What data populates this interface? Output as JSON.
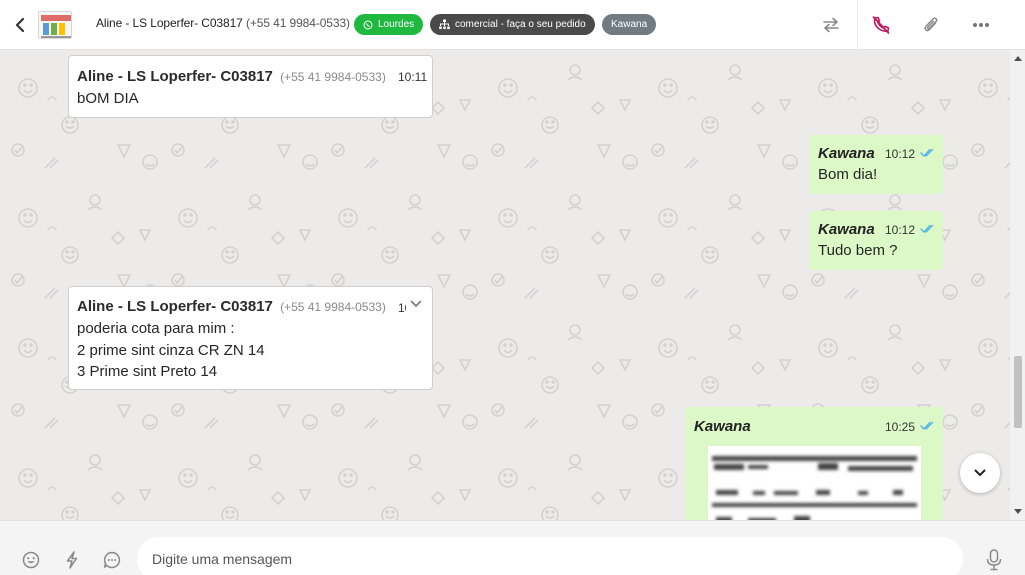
{
  "header": {
    "contact_name": "Aline - LS Loperfer- C03817",
    "contact_phone": "(+55 41 9984-0533)",
    "tags": {
      "lourdes": "Lourdes",
      "comercial": "comercial - faça o seu pedido",
      "kawana": "Kawana"
    },
    "colors": {
      "lourdes": "#1fb93f",
      "comercial": "#4a4a4a",
      "kawana": "#727b82",
      "phone_icon": "#c2185b"
    },
    "icons": [
      "back-arrow-icon",
      "transfer-icon",
      "end-call-icon",
      "paperclip-icon",
      "more-icon"
    ]
  },
  "messages": {
    "m1": {
      "sender": "Aline - LS Loperfer- C03817",
      "phone": "(+55 41 9984-0533)",
      "time": "10:11",
      "text": "bOM DIA"
    },
    "m2": {
      "sender": "Kawana",
      "time": "10:12",
      "text": "Bom dia!"
    },
    "m3": {
      "sender": "Kawana",
      "time": "10:12",
      "text": "Tudo bem ?"
    },
    "m4": {
      "sender": "Aline - LS Loperfer- C03817",
      "phone": "(+55 41 9984-0533)",
      "time": "10",
      "lines": [
        "poderia cota para mim :",
        "2 prime sint cinza CR ZN 14",
        "3 Prime sint Preto 14"
      ]
    },
    "m5": {
      "sender": "Kawana",
      "time": "10:25"
    }
  },
  "input": {
    "placeholder": "Digite uma mensagem"
  },
  "colors": {
    "chat_bg": "#ecebea",
    "outgoing_bubble": "#dcf8c6",
    "read_ticks": "#4fb3e8"
  }
}
